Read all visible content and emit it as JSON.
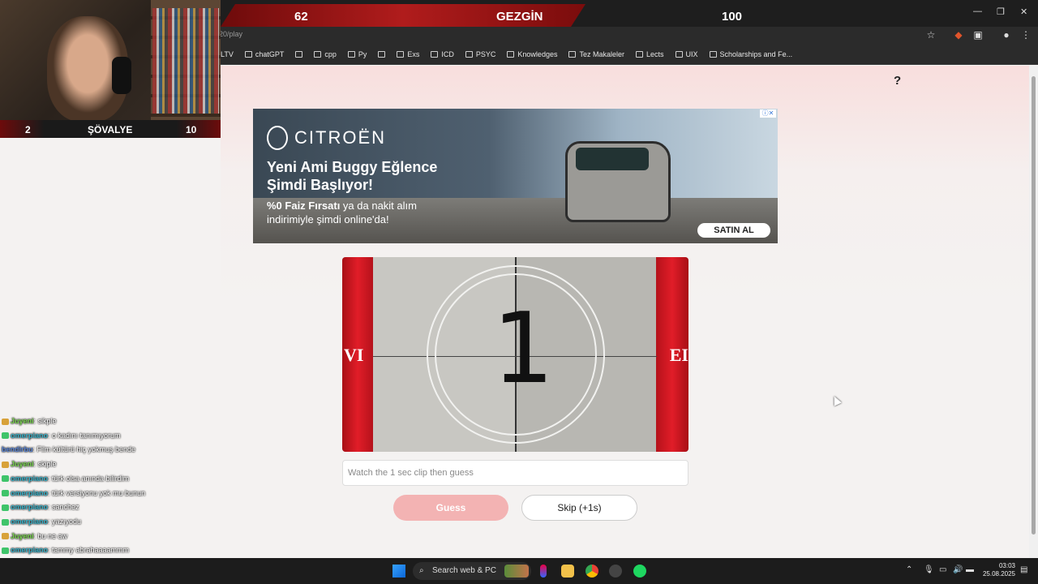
{
  "stream": {
    "score_left": "62",
    "score_title": "GEZGİN",
    "score_right": "100",
    "cam_left": "2",
    "cam_title": "ŞÖVALYE",
    "cam_right": "10"
  },
  "browser": {
    "url": "20/play",
    "bookmarks": [
      {
        "label": "LTV",
        "icon": "none"
      },
      {
        "label": "chatGPT",
        "icon": "openai-icon"
      },
      {
        "label": "",
        "icon": "grid-icon"
      },
      {
        "label": "cpp",
        "icon": "copilot-icon"
      },
      {
        "label": "Py",
        "icon": "python-icon"
      },
      {
        "label": "",
        "icon": "skull-icon"
      },
      {
        "label": "Exs",
        "icon": "folder-icon"
      },
      {
        "label": "ICD",
        "icon": "folder-icon"
      },
      {
        "label": "PSYC",
        "icon": "folder-icon"
      },
      {
        "label": "Knowledges",
        "icon": "folder-icon"
      },
      {
        "label": "Tez Makaleler",
        "icon": "folder-icon"
      },
      {
        "label": "Lects",
        "icon": "folder-icon"
      },
      {
        "label": "UIX",
        "icon": "folder-icon"
      },
      {
        "label": "Scholarships and Fe...",
        "icon": "sheet-icon"
      }
    ]
  },
  "page": {
    "help": "?",
    "ad": {
      "brand": "CITROËN",
      "headline": "Yeni Ami Buggy Eğlence Şimdi Başlıyor!",
      "sub_bold": "%0 Faiz Fırsatı",
      "sub_rest": " ya da nakit alım indirimiyle şimdi online'da!",
      "cta": "SATIN AL"
    },
    "clip": {
      "countdown": "1",
      "left_text": "VI",
      "right_text": "EI"
    },
    "guess_placeholder": "Watch the 1 sec clip then guess",
    "guess_button": "Guess",
    "skip_button": "Skip (+1s)"
  },
  "chat": [
    {
      "user": "Juyeni",
      "msg": ": sikple",
      "user_color": "#7ad64f",
      "badge": "#d8a23a"
    },
    {
      "user": "omerpiano",
      "msg": ": o kadını tanımıyorum",
      "user_color": "#38b2c9",
      "badge": "#3fc46a"
    },
    {
      "user": "bendirbu",
      "msg": ": Film kültürü hiç yokmuş bende",
      "user_color": "#5b86d8",
      "badge": ""
    },
    {
      "user": "Juyeni",
      "msg": ": skiple",
      "user_color": "#7ad64f",
      "badge": "#d8a23a"
    },
    {
      "user": "omerpiano",
      "msg": ": türk olsa anında bilirdim",
      "user_color": "#38b2c9",
      "badge": "#3fc46a"
    },
    {
      "user": "omerpiano",
      "msg": ": türk versiyonu yok mu bunun",
      "user_color": "#38b2c9",
      "badge": "#3fc46a"
    },
    {
      "user": "omerpiano",
      "msg": ": sanchez",
      "user_color": "#38b2c9",
      "badge": "#3fc46a"
    },
    {
      "user": "omerpiano",
      "msg": ": yazıyodu",
      "user_color": "#38b2c9",
      "badge": "#3fc46a"
    },
    {
      "user": "Juyeni",
      "msg": ": bu ne aw",
      "user_color": "#7ad64f",
      "badge": "#d8a23a"
    },
    {
      "user": "omerpiano",
      "msg": ": tammy abrahaaaammm",
      "user_color": "#38b2c9",
      "badge": "#3fc46a"
    }
  ],
  "taskbar": {
    "search": "Search web & PC",
    "time": "03:03",
    "date": "25.08.2025"
  }
}
